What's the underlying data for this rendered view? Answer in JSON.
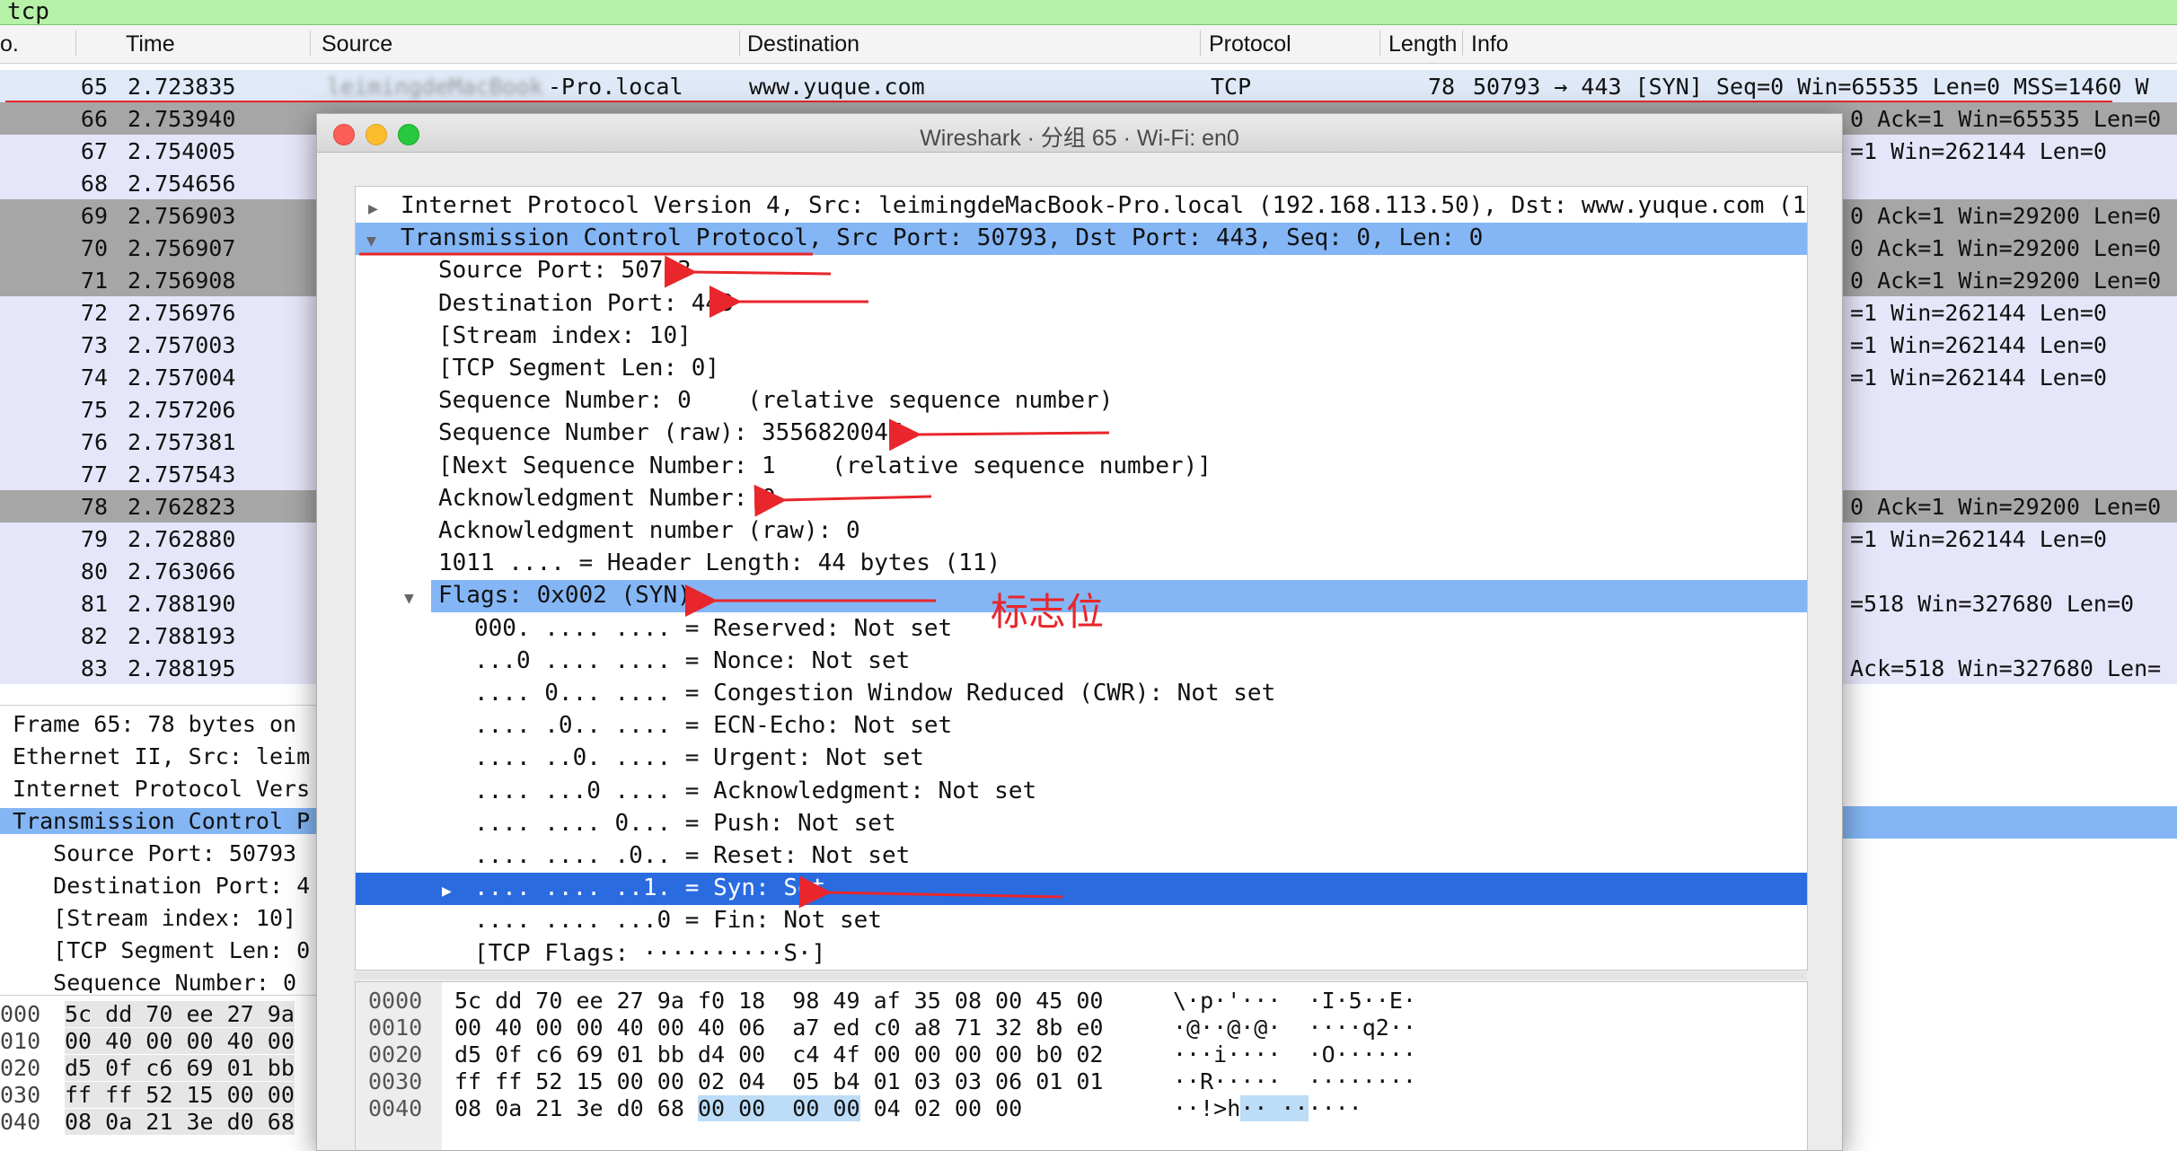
{
  "filter": {
    "text": "tcp"
  },
  "list_header": {
    "no": "o.",
    "time": "Time",
    "source": "Source",
    "destination": "Destination",
    "protocol": "Protocol",
    "length": "Length",
    "info": "Info"
  },
  "selected_row": {
    "no": "65",
    "time": "2.723835",
    "source": "-Pro.local",
    "destination": "www.yuque.com",
    "protocol": "TCP",
    "length": "78",
    "info": "50793 → 443 [SYN] Seq=0 Win=65535 Len=0 MSS=1460 W"
  },
  "rows": [
    {
      "no": "66",
      "time": "2.753940",
      "info": "0 Ack=1 Win=65535 Len=0",
      "shade": "dark"
    },
    {
      "no": "67",
      "time": "2.754005",
      "info": "=1 Win=262144 Len=0",
      "shade": "light"
    },
    {
      "no": "68",
      "time": "2.754656",
      "info": "",
      "shade": "light"
    },
    {
      "no": "69",
      "time": "2.756903",
      "info": "0 Ack=1 Win=29200 Len=0",
      "shade": "dark"
    },
    {
      "no": "70",
      "time": "2.756907",
      "info": "0 Ack=1 Win=29200 Len=0",
      "shade": "dark"
    },
    {
      "no": "71",
      "time": "2.756908",
      "info": "0 Ack=1 Win=29200 Len=0",
      "shade": "dark"
    },
    {
      "no": "72",
      "time": "2.756976",
      "info": "=1 Win=262144 Len=0",
      "shade": "light"
    },
    {
      "no": "73",
      "time": "2.757003",
      "info": "=1 Win=262144 Len=0",
      "shade": "light"
    },
    {
      "no": "74",
      "time": "2.757004",
      "info": "=1 Win=262144 Len=0",
      "shade": "light"
    },
    {
      "no": "75",
      "time": "2.757206",
      "info": "",
      "shade": "light"
    },
    {
      "no": "76",
      "time": "2.757381",
      "info": "",
      "shade": "light"
    },
    {
      "no": "77",
      "time": "2.757543",
      "info": "",
      "shade": "light"
    },
    {
      "no": "78",
      "time": "2.762823",
      "info": "0 Ack=1 Win=29200 Len=0",
      "shade": "dark"
    },
    {
      "no": "79",
      "time": "2.762880",
      "info": "=1 Win=262144 Len=0",
      "shade": "light"
    },
    {
      "no": "80",
      "time": "2.763066",
      "info": "",
      "shade": "light"
    },
    {
      "no": "81",
      "time": "2.788190",
      "info": "=518 Win=327680 Len=0",
      "shade": "light"
    },
    {
      "no": "82",
      "time": "2.788193",
      "info": "",
      "shade": "light"
    },
    {
      "no": "83",
      "time": "2.788195",
      "info": "Ack=518 Win=327680 Len=",
      "shade": "light"
    }
  ],
  "left_detail": [
    "Frame 65: 78 bytes on",
    "Ethernet II, Src: leim",
    "Internet Protocol Vers",
    "Transmission Control P",
    "   Source Port: 50793",
    "   Destination Port: 4",
    "   [Stream index: 10]",
    "   [TCP Segment Len: 0",
    "   Sequence Number: 0"
  ],
  "left_hex": [
    {
      "off": "000",
      "hex": "5c dd 70 ee 27 9a"
    },
    {
      "off": "010",
      "hex": "00 40 00 00 40 00"
    },
    {
      "off": "020",
      "hex": "d5 0f c6 69 01 bb"
    },
    {
      "off": "030",
      "hex": "ff ff 52 15 00 00"
    },
    {
      "off": "040",
      "hex": "08 0a 21 3e d0 68"
    }
  ],
  "window": {
    "title": "Wireshark · 分组 65 · Wi-Fi: en0"
  },
  "tree": [
    {
      "text": "Internet Protocol Version 4, Src: leimingdeMacBook-Pro.local (192.168.113.50), Dst: www.yuque.com (1"
    },
    {
      "text": "Transmission Control Protocol, Src Port: 50793, Dst Port: 443, Seq: 0, Len: 0"
    },
    {
      "text": "Source Port: 50793"
    },
    {
      "text": "Destination Port: 443"
    },
    {
      "text": "[Stream index: 10]"
    },
    {
      "text": "[TCP Segment Len: 0]"
    },
    {
      "text": "Sequence Number: 0    (relative sequence number)"
    },
    {
      "text": "Sequence Number (raw): 3556820047"
    },
    {
      "text": "[Next Sequence Number: 1    (relative sequence number)]"
    },
    {
      "text": "Acknowledgment Number: 0"
    },
    {
      "text": "Acknowledgment number (raw): 0"
    },
    {
      "text": "1011 .... = Header Length: 44 bytes (11)"
    },
    {
      "text": "Flags: 0x002 (SYN)"
    },
    {
      "text": "000. .... .... = Reserved: Not set"
    },
    {
      "text": "...0 .... .... = Nonce: Not set"
    },
    {
      "text": ".... 0... .... = Congestion Window Reduced (CWR): Not set"
    },
    {
      "text": ".... .0.. .... = ECN-Echo: Not set"
    },
    {
      "text": ".... ..0. .... = Urgent: Not set"
    },
    {
      "text": ".... ...0 .... = Acknowledgment: Not set"
    },
    {
      "text": ".... .... 0... = Push: Not set"
    },
    {
      "text": ".... .... .0.. = Reset: Not set"
    },
    {
      "text": ".... .... ..1. = Syn: Set"
    },
    {
      "text": ".... .... ...0 = Fin: Not set"
    },
    {
      "text": "[TCP Flags: ··········S·]"
    }
  ],
  "annotation": {
    "flags_label": "标志位"
  },
  "hex": [
    {
      "off": "0000",
      "hex": "5c dd 70 ee 27 9a f0 18  98 49 af 35 08 00 45 00",
      "asc": "\\·p·'···  ·I·5··E·"
    },
    {
      "off": "0010",
      "hex": "00 40 00 00 40 00 40 06  a7 ed c0 a8 71 32 8b e0",
      "asc": "·@··@·@·  ····q2··"
    },
    {
      "off": "0020",
      "hex": "d5 0f c6 69 01 bb d4 00  c4 4f 00 00 00 00 b0 02",
      "asc": "···i····  ·O······"
    },
    {
      "off": "0030",
      "hex": "ff ff 52 15 00 00 02 04  05 b4 01 03 03 06 01 01",
      "asc": "··R·····  ········"
    },
    {
      "off": "0040",
      "hex": "08 0a 21 3e d0 68 ",
      "hex_hl": "00 00  00 00",
      "hex_tail": " 04 02 00 00",
      "asc": "··!>h",
      "asc_hl": "·· ··",
      "asc_tail": "····"
    }
  ],
  "colors": {
    "filter_bg": "#b5f2a7",
    "selected_row": "#3a78d6",
    "tree_select": "#84b6f5",
    "syn_select": "#2a6be0",
    "row_dark": "#a6a6a6",
    "row_light": "#e6e6fa",
    "annotation": "#e8262b"
  }
}
